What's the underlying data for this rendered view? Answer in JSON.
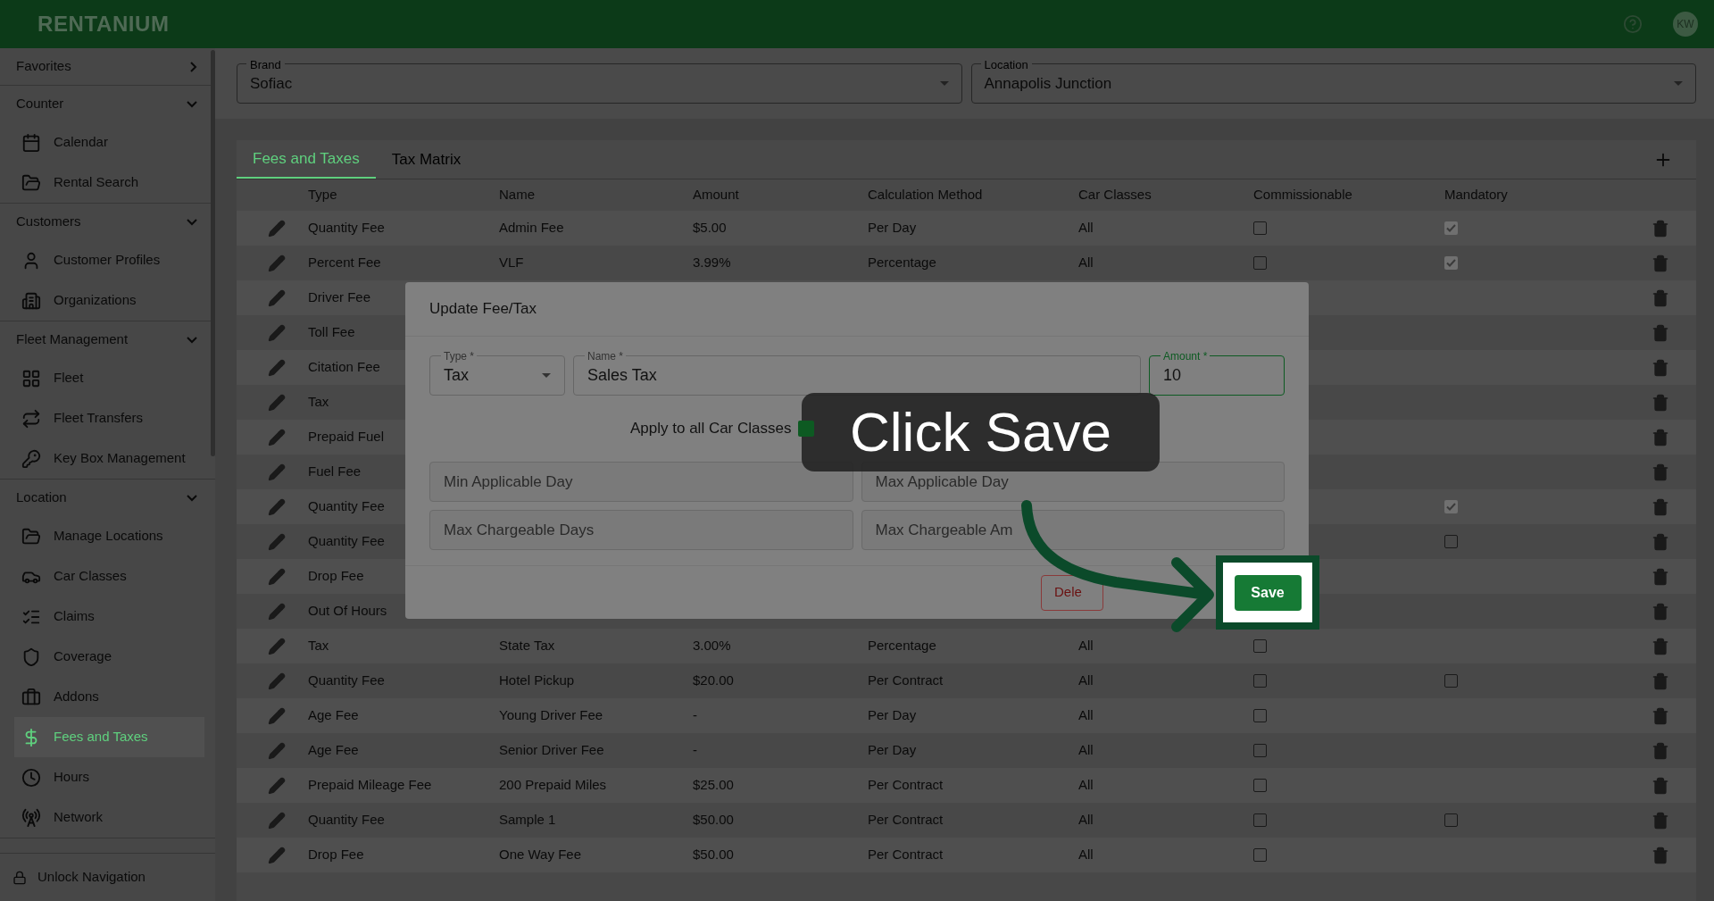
{
  "header": {
    "logo": "RENTANIUM",
    "avatar": "KW"
  },
  "sidebar": {
    "sections": [
      {
        "label": "Favorites",
        "expanded": false
      },
      {
        "label": "Counter",
        "expanded": true,
        "items": [
          {
            "label": "Calendar",
            "selected": false
          },
          {
            "label": "Rental Search",
            "selected": false
          }
        ]
      },
      {
        "label": "Customers",
        "expanded": true,
        "items": [
          {
            "label": "Customer Profiles",
            "selected": false
          },
          {
            "label": "Organizations",
            "selected": false
          }
        ]
      },
      {
        "label": "Fleet Management",
        "expanded": true,
        "items": [
          {
            "label": "Fleet",
            "selected": false
          },
          {
            "label": "Fleet Transfers",
            "selected": false
          },
          {
            "label": "Key Box Management",
            "selected": false
          }
        ]
      },
      {
        "label": "Location",
        "expanded": true,
        "items": [
          {
            "label": "Manage Locations",
            "selected": false
          },
          {
            "label": "Car Classes",
            "selected": false
          },
          {
            "label": "Claims",
            "selected": false
          },
          {
            "label": "Coverage",
            "selected": false
          },
          {
            "label": "Addons",
            "selected": false
          },
          {
            "label": "Fees and Taxes",
            "selected": true
          },
          {
            "label": "Hours",
            "selected": false
          },
          {
            "label": "Network",
            "selected": false
          }
        ]
      }
    ],
    "footer": "Unlock Navigation"
  },
  "filters": [
    {
      "label": "Brand",
      "value": "Sofiac"
    },
    {
      "label": "Location",
      "value": "Annapolis Junction"
    }
  ],
  "tabs": [
    {
      "label": "Fees and Taxes",
      "selected": true
    },
    {
      "label": "Tax Matrix",
      "selected": false
    }
  ],
  "table": {
    "columns": [
      "Type",
      "Name",
      "Amount",
      "Calculation Method",
      "Car Classes",
      "Commissionable",
      "Mandatory"
    ],
    "rows": [
      {
        "type": "Quantity Fee",
        "name": "Admin Fee",
        "amount": "$5.00",
        "method": "Per Day",
        "classes": "All",
        "commissionable": false,
        "mandatory": true
      },
      {
        "type": "Percent Fee",
        "name": "VLF",
        "amount": "3.99%",
        "method": "Percentage",
        "classes": "All",
        "commissionable": false,
        "mandatory": true
      },
      {
        "type": "Driver Fee"
      },
      {
        "type": "Toll Fee"
      },
      {
        "type": "Citation Fee"
      },
      {
        "type": "Tax"
      },
      {
        "type": "Prepaid Fuel"
      },
      {
        "type": "Fuel Fee"
      },
      {
        "type": "Quantity Fee",
        "mandatory": true
      },
      {
        "type": "Quantity Fee",
        "mandatory": false
      },
      {
        "type": "Drop Fee"
      },
      {
        "type": "Out Of Hours"
      },
      {
        "type": "Tax",
        "name": "State Tax",
        "amount": "3.00%",
        "method": "Percentage",
        "classes": "All",
        "commissionable": false
      },
      {
        "type": "Quantity Fee",
        "name": "Hotel Pickup",
        "amount": "$20.00",
        "method": "Per Contract",
        "classes": "All",
        "commissionable": false,
        "mandatory": false
      },
      {
        "type": "Age Fee",
        "name": "Young Driver Fee",
        "amount": "-",
        "method": "Per Day",
        "classes": "All",
        "commissionable": false
      },
      {
        "type": "Age Fee",
        "name": "Senior Driver Fee",
        "amount": "-",
        "method": "Per Day",
        "classes": "All",
        "commissionable": false
      },
      {
        "type": "Prepaid Mileage Fee",
        "name": "200 Prepaid Miles",
        "amount": "$25.00",
        "method": "Per Contract",
        "classes": "All",
        "commissionable": false
      },
      {
        "type": "Quantity Fee",
        "name": "Sample 1",
        "amount": "$50.00",
        "method": "Per Contract",
        "classes": "All",
        "commissionable": false,
        "mandatory": false
      },
      {
        "type": "Drop Fee",
        "name": "One Way Fee",
        "amount": "$50.00",
        "method": "Per Contract",
        "classes": "All",
        "commissionable": false
      }
    ]
  },
  "dialog": {
    "title": "Update Fee/Tax",
    "type": {
      "label": "Type *",
      "value": "Tax"
    },
    "name": {
      "label": "Name *",
      "value": "Sales Tax"
    },
    "amount": {
      "label": "Amount *",
      "value": "10",
      "focused": true
    },
    "apply": {
      "label": "Apply to all Car Classes",
      "checked": true
    },
    "placeholders": [
      "Min Applicable Day",
      "Max Applicable Day",
      "Max Chargeable Days",
      "Max Chargeable Am"
    ],
    "delete": "Dele",
    "save": "Save"
  },
  "callout": "Click Save"
}
